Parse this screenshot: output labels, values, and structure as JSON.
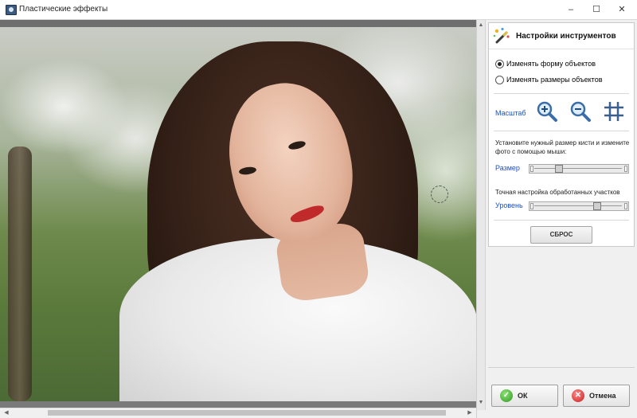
{
  "window": {
    "title": "Пластические эффекты",
    "minimize": "–",
    "maximize": "☐",
    "close": "✕"
  },
  "panel": {
    "title": "Настройки инструментов",
    "radio_options": [
      {
        "label": "Изменять форму объектов",
        "checked": true
      },
      {
        "label": "Изменять размеры объектов",
        "checked": false
      }
    ],
    "zoom_label": "Масштаб",
    "tools": [
      "zoom-in-icon",
      "zoom-out-icon",
      "grid-icon"
    ],
    "hint": "Установите нужный размер кисти и измените фото с помощью мыши:",
    "size_label": "Размер",
    "size_slider_value": 0.28,
    "level_hint": "Точная настройка обработанных участков",
    "level_label": "Уровень",
    "level_slider_value": 0.72,
    "reset_label": "СБРОС"
  },
  "footer": {
    "ok_label": "ОК",
    "cancel_label": "Отмена"
  },
  "colors": {
    "accent_label": "#1a4fc8",
    "ok_icon": "#2e9a1c",
    "cancel_icon": "#c81e1e"
  }
}
